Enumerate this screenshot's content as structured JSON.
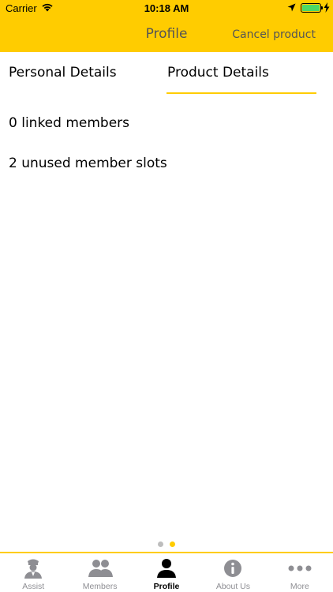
{
  "status_bar": {
    "carrier": "Carrier",
    "time": "10:18 AM"
  },
  "header": {
    "title": "Profile",
    "action_label": "Cancel product"
  },
  "tabs": [
    {
      "label": "Personal Details",
      "selected": false
    },
    {
      "label": "Product Details",
      "selected": true
    }
  ],
  "content": {
    "linked_members": "0 linked members",
    "unused_slots": "2 unused member slots"
  },
  "page_indicator": {
    "count": 2,
    "current": 2
  },
  "tab_bar": {
    "items": [
      {
        "label": "Assist",
        "icon": "chauffeur-icon",
        "active": false
      },
      {
        "label": "Members",
        "icon": "members-icon",
        "active": false
      },
      {
        "label": "Profile",
        "icon": "person-icon",
        "active": true
      },
      {
        "label": "About Us",
        "icon": "info-icon",
        "active": false
      },
      {
        "label": "More",
        "icon": "more-icon",
        "active": false
      }
    ]
  },
  "colors": {
    "brand_yellow": "#ffcc00",
    "inactive_gray": "#8e8e93",
    "battery_green": "#4cd964"
  }
}
